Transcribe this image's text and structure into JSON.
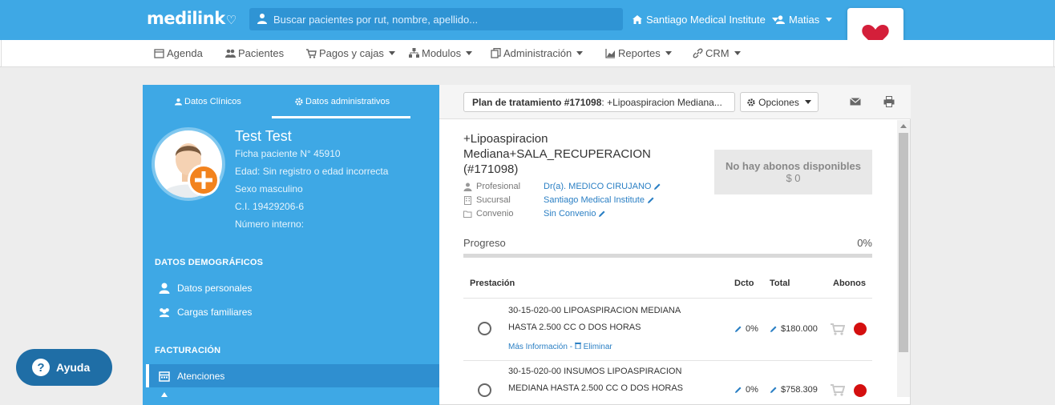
{
  "header": {
    "logo": "medilink",
    "search_placeholder": "Buscar pacientes por rut, nombre, apellido...",
    "institution": "Santiago Medical Institute",
    "user": "Matias",
    "accent": "#3ea8e5",
    "brand_heart_color": "#d41f3a"
  },
  "menu": {
    "items": [
      {
        "label": "Agenda",
        "icon": "calendar-icon"
      },
      {
        "label": "Pacientes",
        "icon": "users-icon"
      },
      {
        "label": "Pagos y cajas",
        "icon": "cart-icon"
      },
      {
        "label": "Modulos",
        "icon": "sitemap-icon"
      },
      {
        "label": "Administración",
        "icon": "copy-icon"
      },
      {
        "label": "Reportes",
        "icon": "area-chart-icon"
      },
      {
        "label": "CRM",
        "icon": "link-icon"
      }
    ]
  },
  "patient": {
    "tabs": [
      "Datos Clínicos",
      "Datos administrativos"
    ],
    "name": "Test Test",
    "ficha": "Ficha paciente N° 45910",
    "edad": "Edad: Sin registro o edad incorrecta",
    "sexo": "Sexo masculino",
    "ci": "C.I. 19429206-6",
    "numero_interno": "Número interno:"
  },
  "sidebar": {
    "demo_title": "DATOS DEMOGRÁFICOS",
    "datos_personales": "Datos personales",
    "cargas_familiares": "Cargas familiares",
    "fact_title": "FACTURACIÓN",
    "atenciones": "Atenciones"
  },
  "plan": {
    "button_bold": "Plan de tratamiento #171098",
    "button_rest": ": +Lipoaspiracion Mediana...",
    "opciones": "Opciones",
    "title": "+Lipoaspiracion Mediana+SALA_RECUPERACION (#171098)",
    "profesional_label": "Profesional",
    "profesional_value": "Dr(a). MEDICO CIRUJANO",
    "sucursal_label": "Sucursal",
    "sucursal_value": "Santiago Medical Institute",
    "convenio_label": "Convenio",
    "convenio_value": "Sin Convenio",
    "abonos_title": "No hay abonos disponibles",
    "abonos_amount": "$ 0",
    "progress_label": "Progreso",
    "progress_pct": "0%",
    "progress_value": 0
  },
  "table": {
    "headers": {
      "prestacion": "Prestación",
      "dcto": "Dcto",
      "total": "Total",
      "abonos": "Abonos"
    },
    "rows": [
      {
        "line1": "30-15-020-00 LIPOASPIRACION MEDIANA",
        "line2": "HASTA 2.500 CC O DOS HORAS",
        "more": "Más Información - ",
        "delete": "Eliminar",
        "dcto": "0%",
        "total": "$180.000"
      },
      {
        "line1": "30-15-020-00 INSUMOS LIPOASPIRACION",
        "line2": "MEDIANA HASTA 2.500 CC O DOS HORAS",
        "dcto": "0%",
        "total": "$758.309"
      }
    ],
    "status_color": "#d40f0f"
  },
  "help": {
    "label": "Ayuda"
  }
}
